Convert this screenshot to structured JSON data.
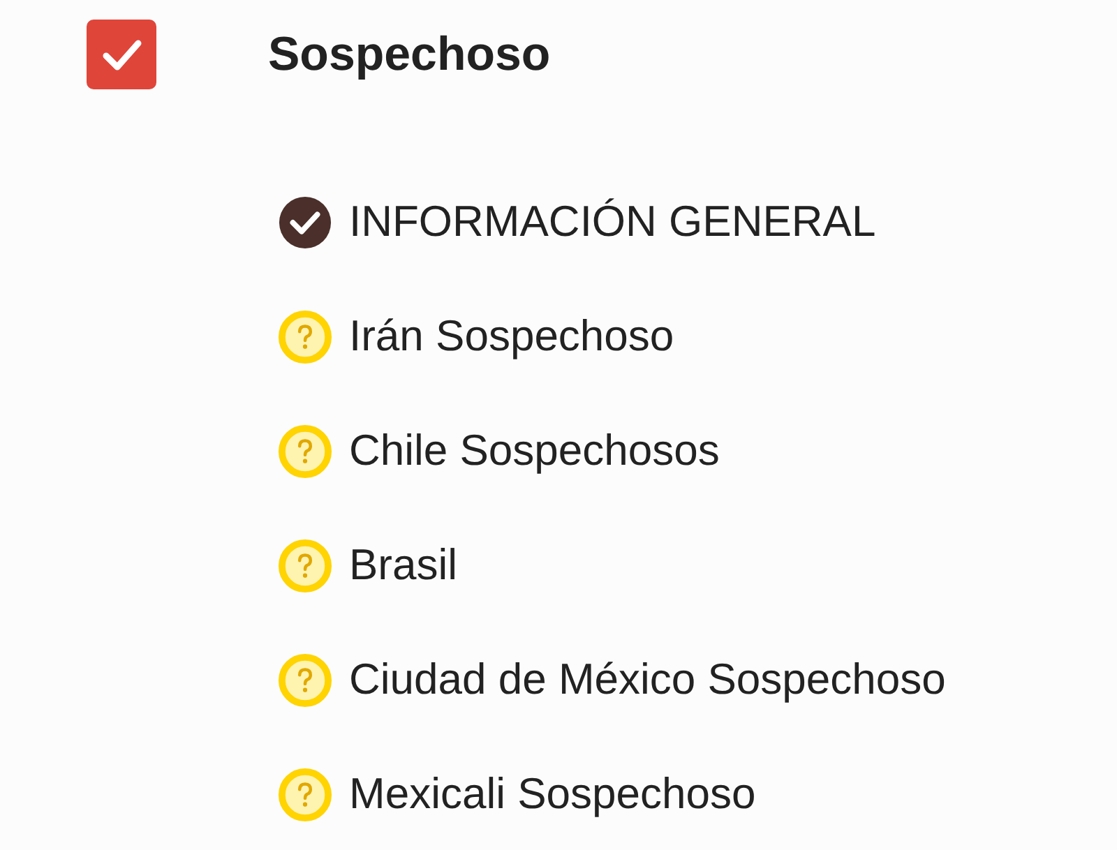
{
  "header": {
    "title": "Sospechoso",
    "checked": true
  },
  "items": [
    {
      "label": "INFORMACIÓN GENERAL",
      "kind": "done"
    },
    {
      "label": "Irán Sospechoso",
      "kind": "pending"
    },
    {
      "label": "Chile Sospechosos",
      "kind": "pending"
    },
    {
      "label": "Brasil",
      "kind": "pending"
    },
    {
      "label": "Ciudad de México Sospechoso",
      "kind": "pending"
    },
    {
      "label": "Mexicali Sospechoso",
      "kind": "pending"
    }
  ]
}
